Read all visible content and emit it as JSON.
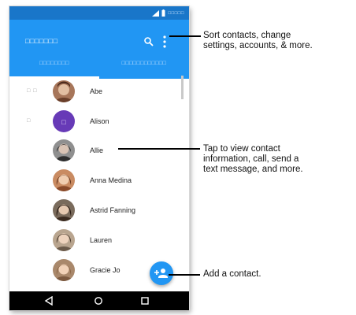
{
  "phone": {
    "status_bar": {
      "time": "□□□□□"
    },
    "app_bar": {
      "title": "□□□□□□□",
      "tabs": [
        {
          "label": "□□□□□□□□"
        },
        {
          "label": "□□□□□□□□□□□□"
        }
      ]
    },
    "contacts": [
      {
        "name": "Abe",
        "index_letter": "□ □"
      },
      {
        "name": "Alison",
        "index_letter": "□",
        "initial": "□"
      },
      {
        "name": "Allie"
      },
      {
        "name": "Anna Medina"
      },
      {
        "name": "Astrid Fanning"
      },
      {
        "name": "Lauren"
      },
      {
        "name": "Gracie Jo"
      }
    ],
    "colors": {
      "status_bar": "#1976c9",
      "app_bar": "#2196f3",
      "fab": "#2196f3",
      "alison_avatar": "#673ab7"
    }
  },
  "callouts": {
    "menu": "Sort contacts, change\nsettings, accounts, & more.",
    "contact": "Tap to view contact\ninformation, call, send a\ntext message, and more.",
    "add": "Add a contact."
  }
}
